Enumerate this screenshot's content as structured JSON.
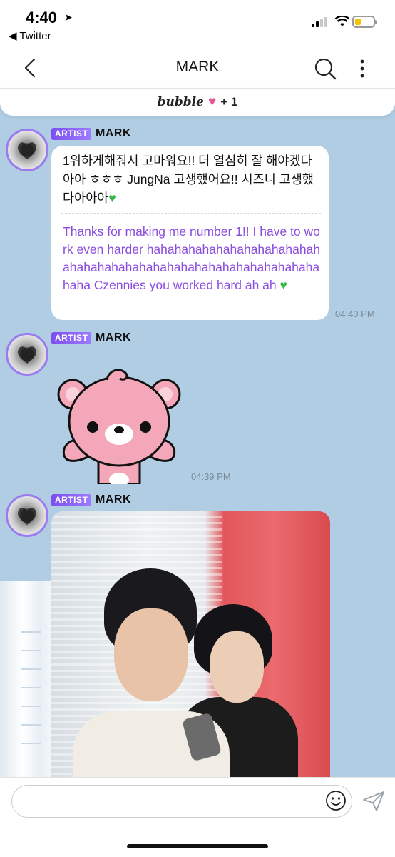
{
  "status_bar": {
    "time": "4:40",
    "back_app": "◀ Twitter"
  },
  "header": {
    "title": "MARK"
  },
  "banner": {
    "label": "bubble",
    "count": "+ 1"
  },
  "messages": [
    {
      "badge": "ARTIST",
      "sender": "MARK",
      "text_ko": "1위하게해줘서 고마워요!! 더 열심히 잘 해야겠다아아 ㅎㅎㅎ JungNa 고생했어요!! 시즈니 고생했다아아아",
      "text_en": "Thanks for making me number 1!! I have to work even harder hahahahahahahahahahahahahahahahahahahahahahahahahahahahahahahahaha Czennies you worked hard ah ah",
      "time": "04:40 PM"
    },
    {
      "badge": "ARTIST",
      "sender": "MARK",
      "time": "04:39 PM"
    },
    {
      "badge": "ARTIST",
      "sender": "MARK"
    }
  ],
  "colors": {
    "chat_background": "#b0cde4",
    "artist_badge": "#7b4ff0",
    "translation_text": "#8a4de0",
    "heart_pink": "#e4589a",
    "heart_green": "#39b54a"
  }
}
